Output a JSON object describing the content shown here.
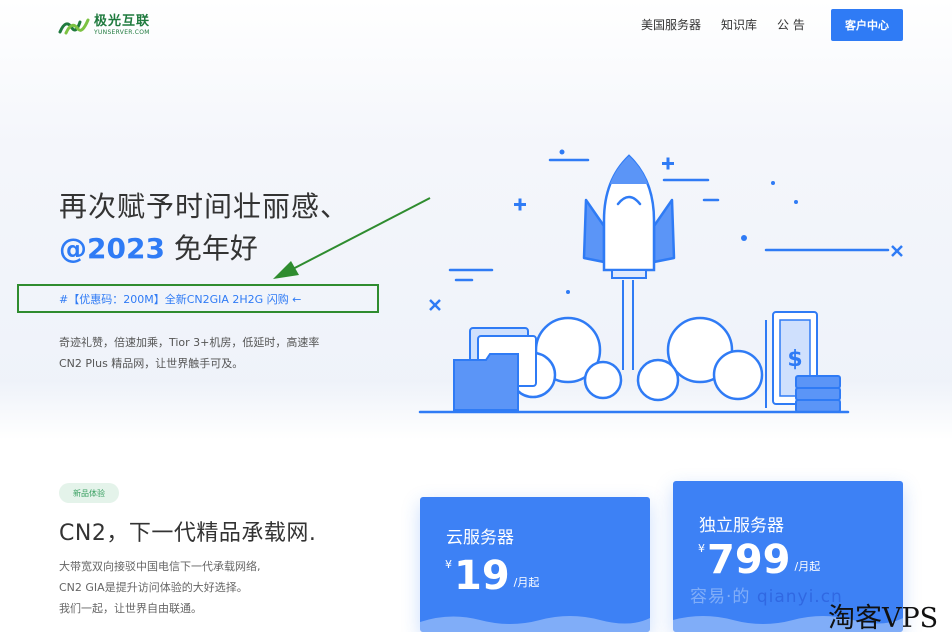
{
  "header": {
    "logo_cn": "极光互联",
    "logo_en": "YUNSERVER.COM",
    "nav": [
      "美国服务器",
      "知识库",
      "公 告"
    ],
    "cta": "客户中心"
  },
  "hero": {
    "title": "再次赋予时间壮丽感、",
    "subtitle_accent": "@2023",
    "subtitle_rest": " 免年好",
    "promo": "#【优惠码：200M】全新CN2GIA 2H2G 闪购 ←",
    "desc_line1": "奇迹礼赞，倍速加乘，Tior 3+机房，低延时，高速率",
    "desc_line2": "CN2 Plus 精品网，让世界触手可及。"
  },
  "section": {
    "badge": "新品体验",
    "title": "CN2，下一代精品承载网.",
    "desc_line1": "大带宽双向接驳中国电信下一代承载网络,",
    "desc_line2": "CN2 GIA是提升访问体验的大好选择。",
    "desc_line3": "我们一起，让世界自由联通。"
  },
  "cards": [
    {
      "title": "云服务器",
      "currency": "¥",
      "price": "19",
      "unit": "/月起"
    },
    {
      "title": "独立服务器",
      "currency": "¥",
      "price": "799",
      "unit": "/月起"
    }
  ],
  "watermarks": {
    "overlay_cn": "容易·的",
    "overlay_blue": "qianyi.cn",
    "corner": "淘客VPS"
  },
  "colors": {
    "accent": "#2f7bf5",
    "card": "#3d81f5",
    "logo_green": "#1f7a3e",
    "annotation_green": "#2f8c2f"
  }
}
